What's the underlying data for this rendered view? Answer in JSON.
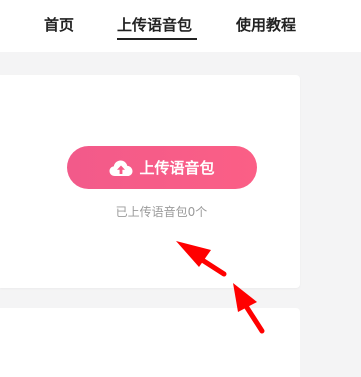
{
  "nav": {
    "home": "首页",
    "upload": "上传语音包",
    "tutorial": "使用教程",
    "active": "upload"
  },
  "upload": {
    "button_label": "上传语音包",
    "button_icon": "cloud-upload-icon",
    "count_text": "已上传语音包0个",
    "uploaded_count": 0
  },
  "colors": {
    "accent": "#f75c88",
    "annotation": "#ff0000",
    "background": "#f4f4f5"
  }
}
